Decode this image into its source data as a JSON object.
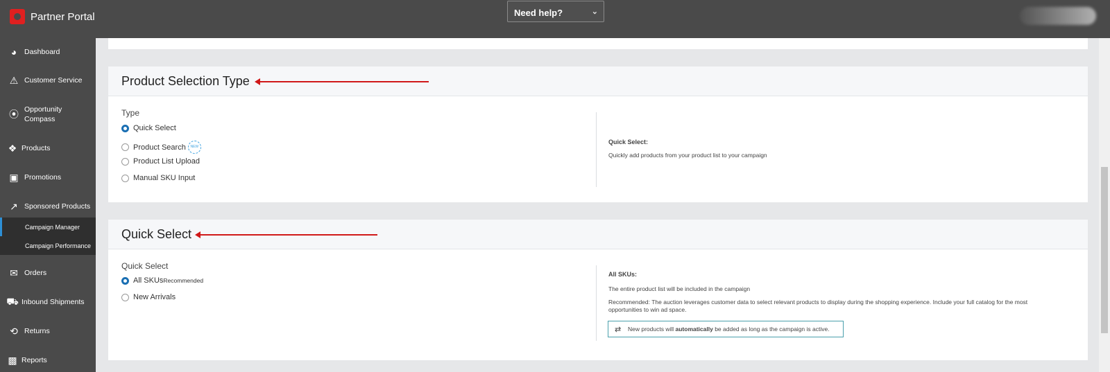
{
  "header": {
    "brand": "Partner Portal",
    "help_label": "Need help?"
  },
  "sidebar": {
    "items": [
      {
        "label": "Dashboard",
        "icon": "dashboard-icon"
      },
      {
        "label": "Customer Service",
        "icon": "warning-icon"
      },
      {
        "label": "Opportunity Compass",
        "icon": "compass-icon"
      },
      {
        "label": "Products",
        "icon": "tag-icon"
      },
      {
        "label": "Promotions",
        "icon": "money-icon"
      },
      {
        "label": "Sponsored Products",
        "icon": "chart-line-icon"
      },
      {
        "label": "Orders",
        "icon": "inbox-icon"
      },
      {
        "label": "Inbound Shipments",
        "icon": "truck-icon"
      },
      {
        "label": "Returns",
        "icon": "returns-icon"
      },
      {
        "label": "Reports",
        "icon": "bar-chart-icon"
      }
    ],
    "sub_items": [
      {
        "label": "Campaign Manager",
        "active": true
      },
      {
        "label": "Campaign Performance",
        "active": false
      }
    ]
  },
  "product_selection": {
    "title": "Product Selection Type",
    "type_label": "Type",
    "options": [
      {
        "label": "Quick Select",
        "selected": true
      },
      {
        "label": "Product Search",
        "selected": false,
        "badge": "NEW"
      },
      {
        "label": "Product List Upload",
        "selected": false
      },
      {
        "label": "Manual SKU Input",
        "selected": false
      }
    ],
    "info_title": "Quick Select:",
    "info_text": "Quickly add products from your product list to your campaign"
  },
  "quick_select": {
    "title": "Quick Select",
    "label": "Quick Select",
    "options": [
      {
        "label": "All SKUs",
        "suffix": "Recommended",
        "selected": true
      },
      {
        "label": "New Arrivals",
        "selected": false
      }
    ],
    "info_title": "All SKUs:",
    "info_text1": "The entire product list will be included in the campaign",
    "info_text2": "Recommended: The auction leverages customer data to select relevant products to display during the shopping experience. Include your full catalog for the most opportunities to win ad space.",
    "notice_pre": "New products will ",
    "notice_bold": "automatically",
    "notice_post": " be added as long as the campaign is active."
  },
  "colors": {
    "header_bg": "#4a4a4a",
    "accent": "#1a6fb3",
    "annotation_arrow": "#d01818",
    "notice_border": "#4aa0ac"
  }
}
